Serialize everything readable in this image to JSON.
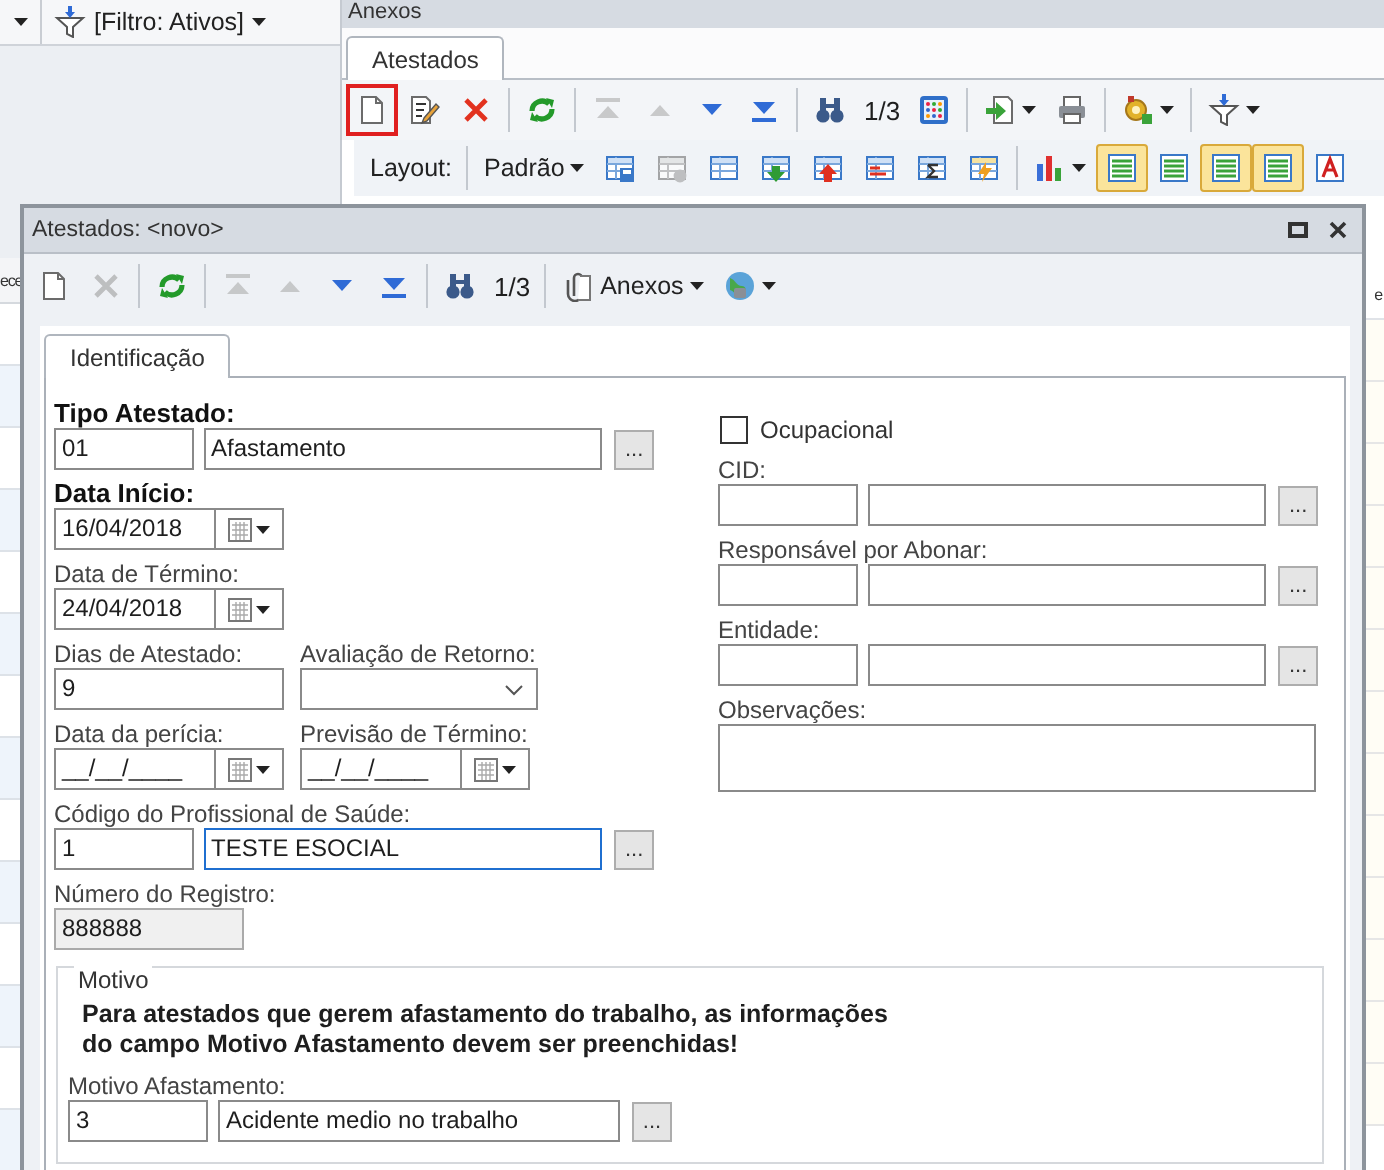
{
  "background": {
    "filter": {
      "label": "[Filtro: Ativos]",
      "dropdown": true
    },
    "left_grid_fragment": "ece",
    "right_grid_fragment": "e"
  },
  "anexos_panel": {
    "title": "Anexos",
    "tabs": [
      {
        "label": "Atestados",
        "selected": true
      }
    ],
    "toolbar": [
      [
        {
          "kind": "new",
          "disabled": false,
          "highlighted": true,
          "dropdown": false
        },
        {
          "kind": "edit",
          "disabled": false,
          "highlighted": false,
          "dropdown": false
        },
        {
          "kind": "delete",
          "disabled": false,
          "highlighted": false,
          "dropdown": false
        }
      ],
      [
        {
          "kind": "refresh",
          "disabled": false,
          "highlighted": false,
          "dropdown": false
        }
      ],
      [
        {
          "kind": "first",
          "disabled": true,
          "highlighted": false,
          "dropdown": false
        },
        {
          "kind": "prev",
          "disabled": true,
          "highlighted": false,
          "dropdown": false
        },
        {
          "kind": "next",
          "disabled": false,
          "highlighted": false,
          "dropdown": false
        },
        {
          "kind": "last",
          "disabled": false,
          "highlighted": false,
          "dropdown": false
        }
      ],
      [
        {
          "kind": "find",
          "disabled": false,
          "highlighted": false,
          "dropdown": false
        },
        {
          "kind": "counter",
          "text": "1/3"
        },
        {
          "kind": "grid",
          "disabled": false,
          "highlighted": false,
          "dropdown": false
        }
      ],
      [
        {
          "kind": "export",
          "disabled": false,
          "highlighted": false,
          "dropdown": true
        },
        {
          "kind": "print",
          "disabled": false,
          "highlighted": false,
          "dropdown": false
        }
      ],
      [
        {
          "kind": "plugin",
          "disabled": false,
          "highlighted": false,
          "dropdown": true
        }
      ],
      [
        {
          "kind": "filter",
          "disabled": false,
          "highlighted": false,
          "dropdown": true
        }
      ]
    ],
    "layout_bar": {
      "label": "Layout:",
      "groups": [
        [
          {
            "kind": "menu",
            "text": "Padrão",
            "dropdown": true,
            "disabled": false,
            "selected": false
          },
          {
            "kind": "save",
            "dropdown": false,
            "disabled": false,
            "selected": false
          },
          {
            "kind": "clear",
            "dropdown": false,
            "disabled": true,
            "selected": false
          },
          {
            "kind": "table",
            "dropdown": false,
            "disabled": false,
            "selected": false
          },
          {
            "kind": "down",
            "dropdown": false,
            "disabled": false,
            "selected": false
          },
          {
            "kind": "up",
            "dropdown": false,
            "disabled": false,
            "selected": false
          },
          {
            "kind": "columns",
            "dropdown": false,
            "disabled": false,
            "selected": false
          },
          {
            "kind": "sum",
            "dropdown": false,
            "disabled": false,
            "selected": false
          },
          {
            "kind": "flash",
            "dropdown": false,
            "disabled": false,
            "selected": false
          }
        ],
        [
          {
            "kind": "chart",
            "dropdown": true,
            "disabled": false,
            "selected": false
          },
          {
            "kind": "view",
            "dropdown": false,
            "disabled": false,
            "selected": true
          },
          {
            "kind": "view",
            "dropdown": false,
            "disabled": false,
            "selected": false
          },
          {
            "kind": "view",
            "dropdown": false,
            "disabled": false,
            "selected": true
          },
          {
            "kind": "view",
            "dropdown": false,
            "disabled": false,
            "selected": true
          },
          {
            "kind": "font",
            "dropdown": false,
            "disabled": false,
            "selected": false
          }
        ]
      ]
    }
  },
  "dialog": {
    "title": "Atestados: <novo>",
    "toolbar": [
      [
        {
          "kind": "new",
          "disabled": false,
          "dropdown": false
        },
        {
          "kind": "delete",
          "disabled": true,
          "dropdown": false
        }
      ],
      [
        {
          "kind": "refresh",
          "disabled": false,
          "dropdown": false
        }
      ],
      [
        {
          "kind": "first",
          "disabled": true,
          "dropdown": false
        },
        {
          "kind": "prev",
          "disabled": true,
          "dropdown": false
        },
        {
          "kind": "next",
          "disabled": false,
          "dropdown": false
        },
        {
          "kind": "last",
          "disabled": false,
          "dropdown": false
        }
      ],
      [
        {
          "kind": "find",
          "disabled": false,
          "dropdown": false
        },
        {
          "kind": "counter",
          "text": "1/3"
        }
      ],
      [
        {
          "kind": "attach",
          "text": "Anexos",
          "disabled": false,
          "dropdown": true
        },
        {
          "kind": "globe",
          "disabled": false,
          "dropdown": true
        }
      ]
    ],
    "tabs": [
      {
        "label": "Identificação",
        "selected": true
      }
    ],
    "form": {
      "tipo_atestado": {
        "label": "Tipo Atestado:",
        "required": true,
        "code": "01",
        "description": "Afastamento",
        "button": "...",
        "focused": false
      },
      "data_inicio": {
        "label": "Data Início:",
        "required": true,
        "value": "16/04/2018"
      },
      "data_termino": {
        "label": "Data de Término:",
        "required": false,
        "value": "24/04/2018"
      },
      "dias_atestado": {
        "label": "Dias de Atestado:",
        "required": false,
        "value": "9",
        "disabled": false
      },
      "avaliacao_retorno": {
        "label": "Avaliação de Retorno:",
        "required": false
      },
      "data_pericia": {
        "label": "Data da perícia:",
        "required": false,
        "value": "__/__/____"
      },
      "previsao_termino": {
        "label": "Previsão de Término:",
        "required": false,
        "value": "__/__/____"
      },
      "codigo_profissional": {
        "label": "Código do Profissional de Saúde:",
        "required": false,
        "code": "1",
        "description": "TESTE ESOCIAL",
        "button": "...",
        "focused": true
      },
      "numero_registro": {
        "label": "Número do Registro:",
        "required": false,
        "value": "888888",
        "disabled": true
      },
      "ocupacional": {
        "label": "Ocupacional",
        "checked": false
      },
      "cid": {
        "label": "CID:",
        "required": false,
        "button": "...",
        "focused": false
      },
      "responsavel": {
        "label": "Responsável por Abonar:",
        "required": false,
        "button": "...",
        "focused": false
      },
      "entidade": {
        "label": "Entidade:",
        "required": false,
        "button": "...",
        "focused": false
      },
      "observacoes": {
        "label": "Observações:",
        "required": false
      },
      "motivo": {
        "title": "Motivo",
        "message": "Para atestados que gerem afastamento do trabalho, as informações\ndo campo Motivo Afastamento devem ser preenchidas!",
        "field": {
          "label": "Motivo Afastamento:",
          "required": false,
          "code": "3",
          "description": "Acidente medio no trabalho",
          "button": "...",
          "focused": false
        }
      }
    }
  }
}
